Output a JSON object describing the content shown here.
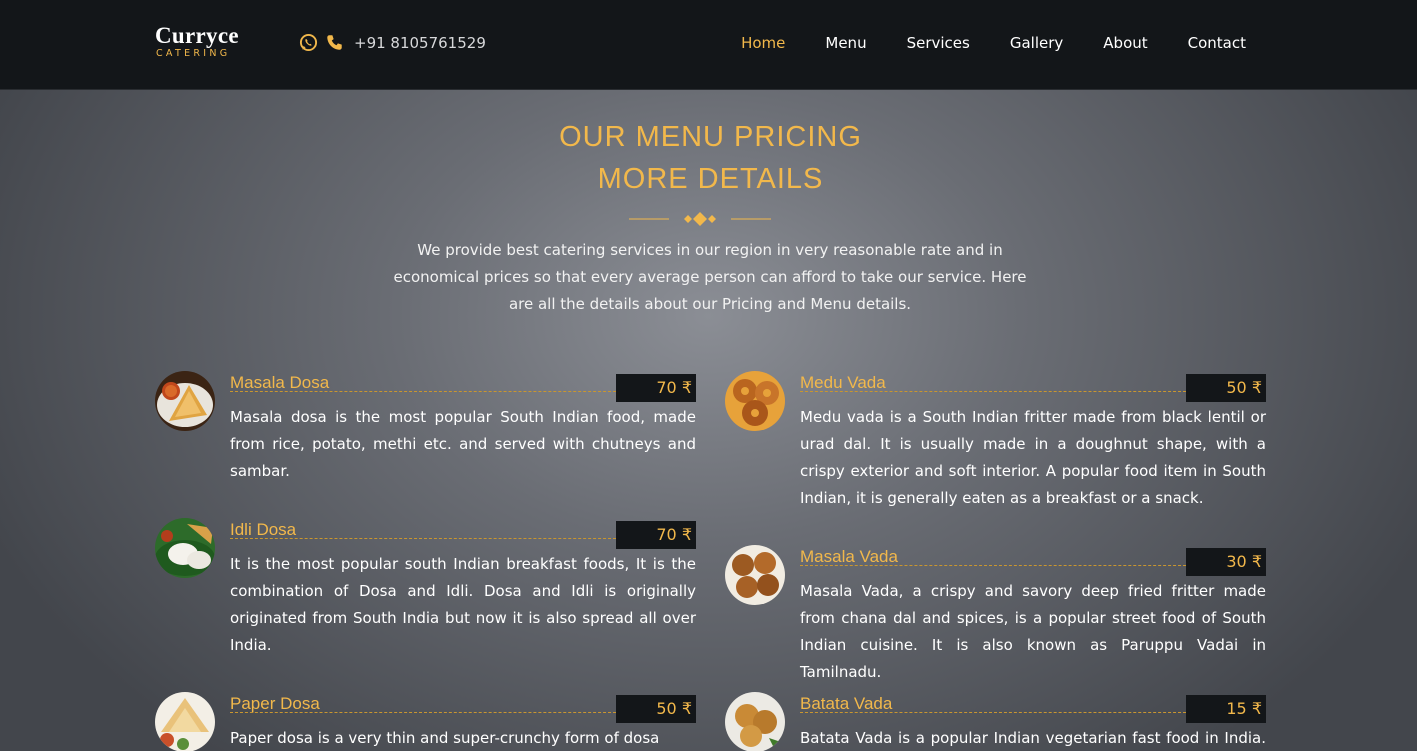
{
  "header": {
    "logo_main": "Curryce",
    "logo_sub": "CATERING",
    "phone": "+91 8105761529",
    "icons": [
      "whatsapp-icon",
      "phone-icon"
    ],
    "nav": [
      {
        "label": "Home",
        "active": true
      },
      {
        "label": "Menu",
        "active": false
      },
      {
        "label": "Services",
        "active": false
      },
      {
        "label": "Gallery",
        "active": false
      },
      {
        "label": "About",
        "active": false
      },
      {
        "label": "Contact",
        "active": false
      }
    ]
  },
  "section": {
    "title_line1": "OUR MENU PRICING",
    "title_line2": "MORE DETAILS",
    "intro": "We provide best catering services in our region in very reasonable rate and in economical prices so that every average person can afford to take our service. Here are all the details about our Pricing and Menu details."
  },
  "colors": {
    "accent": "#f2b84b",
    "header_bg": "#131619",
    "price_bg": "#131619"
  },
  "menu": {
    "left": [
      {
        "name": "Masala Dosa",
        "price": "70 ₹",
        "description": "Masala dosa is the most popular South Indian food, made from rice, potato, methi etc. and served with chutneys and sambar."
      },
      {
        "name": "Idli Dosa",
        "price": "70 ₹",
        "description": "It is the most popular south Indian breakfast foods, It is the combination of Dosa and Idli. Dosa and Idli is originally originated from South India but now it is also spread all over India."
      },
      {
        "name": "Paper Dosa",
        "price": "50 ₹",
        "description": "Paper dosa is a very thin and super-crunchy form of dosa"
      }
    ],
    "right": [
      {
        "name": "Medu Vada",
        "price": "50 ₹",
        "description": "Medu vada is a South Indian fritter made from black lentil or urad dal. It is usually made in a doughnut shape, with a crispy exterior and soft interior. A popular food item in South Indian, it is generally eaten as a breakfast or a snack."
      },
      {
        "name": "Masala Vada",
        "price": "30 ₹",
        "description": "Masala Vada, a crispy and savory deep fried fritter made from chana dal and spices, is a popular street food of South Indian cuisine. It is also known as Paruppu Vadai in Tamilnadu."
      },
      {
        "name": "Batata Vada",
        "price": "15 ₹",
        "description": "Batata Vada is a popular Indian vegetarian fast food in India. It"
      }
    ]
  }
}
